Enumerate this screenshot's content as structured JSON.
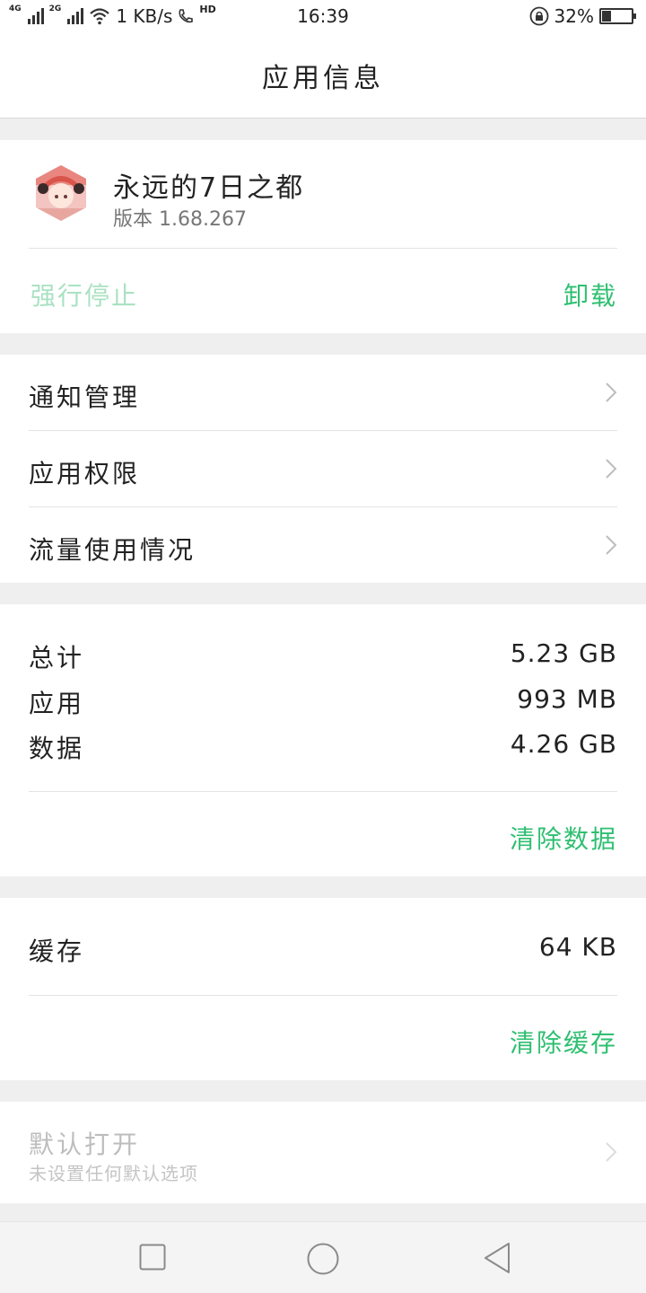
{
  "status_bar": {
    "net1": "4G",
    "net2": "2G",
    "speed": "1 KB/s",
    "hd": "HD",
    "time": "16:39",
    "battery_percent_text": "32%",
    "battery_level": 0.32,
    "icons": [
      "signal-icon",
      "wifi-icon",
      "call-hd-icon",
      "rotation-lock-icon",
      "battery-icon"
    ]
  },
  "header": {
    "title": "应用信息"
  },
  "app": {
    "name": "永远的7日之都",
    "version": "版本 1.68.267",
    "force_stop": "强行停止",
    "uninstall": "卸载",
    "icon": "app-avatar-icon"
  },
  "menu": [
    {
      "label": "通知管理"
    },
    {
      "label": "应用权限"
    },
    {
      "label": "流量使用情况"
    }
  ],
  "storage": {
    "total_label": "总计",
    "total_value": "5.23 GB",
    "app_label": "应用",
    "app_value": "993 MB",
    "data_label": "数据",
    "data_value": "4.26 GB",
    "clear_data": "清除数据"
  },
  "cache": {
    "label": "缓存",
    "value": "64 KB",
    "clear_cache": "清除缓存"
  },
  "defaults": {
    "title": "默认打开",
    "subtitle": "未设置任何默认选项"
  },
  "colors": {
    "accent": "#2fbf71",
    "accent_disabled": "#a9e2c2",
    "disabled_text": "#bdbdbd"
  },
  "nav_icons": [
    "recent-apps-icon",
    "home-icon",
    "back-icon"
  ]
}
